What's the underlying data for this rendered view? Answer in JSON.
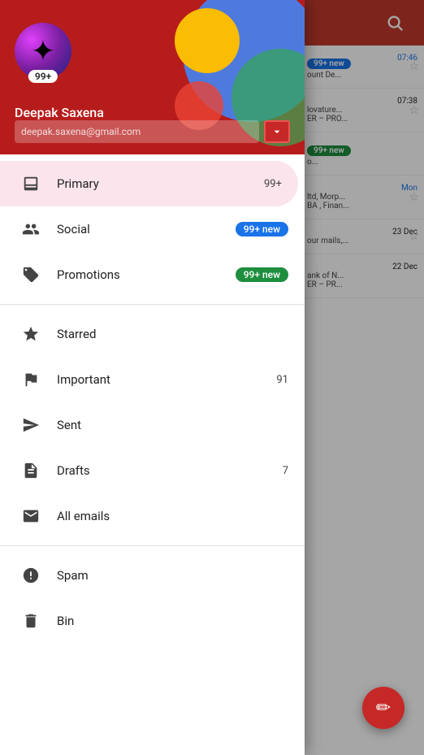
{
  "header": {
    "search_label": "Search"
  },
  "drawer": {
    "user_name": "Deepak Saxena",
    "user_email": "deepak.saxena@gmail.com",
    "unread_count": "99+",
    "nav_items": [
      {
        "id": "primary",
        "label": "Primary",
        "count": "99+",
        "badge": null,
        "active": true,
        "icon": "inbox"
      },
      {
        "id": "social",
        "label": "Social",
        "count": null,
        "badge": "99+ new",
        "badge_color": "blue",
        "active": false,
        "icon": "social"
      },
      {
        "id": "promotions",
        "label": "Promotions",
        "count": null,
        "badge": "99+ new",
        "badge_color": "green",
        "active": false,
        "icon": "promotions"
      },
      {
        "id": "starred",
        "label": "Starred",
        "count": null,
        "badge": null,
        "active": false,
        "icon": "star"
      },
      {
        "id": "important",
        "label": "Important",
        "count": "91",
        "badge": null,
        "active": false,
        "icon": "important"
      },
      {
        "id": "sent",
        "label": "Sent",
        "count": null,
        "badge": null,
        "active": false,
        "icon": "sent"
      },
      {
        "id": "drafts",
        "label": "Drafts",
        "count": "7",
        "badge": null,
        "active": false,
        "icon": "drafts"
      },
      {
        "id": "all",
        "label": "All emails",
        "count": null,
        "badge": null,
        "active": false,
        "icon": "all"
      },
      {
        "id": "spam",
        "label": "Spam",
        "count": null,
        "badge": null,
        "active": false,
        "icon": "spam"
      },
      {
        "id": "bin",
        "label": "Bin",
        "count": null,
        "badge": null,
        "active": false,
        "icon": "bin"
      }
    ]
  },
  "email_bg": {
    "items": [
      {
        "badge": "99+ new",
        "badge_color": "blue",
        "time": "07:46",
        "snippet": "ount De...",
        "has_star": true
      },
      {
        "badge": null,
        "time": "07:38",
        "snippet": "lovature...",
        "snippet2": "ER – PRO...",
        "has_star": true
      },
      {
        "badge": "99+ new",
        "badge_color": "green",
        "time": "",
        "snippet": "o...",
        "has_star": false
      },
      {
        "badge": null,
        "time": "Mon",
        "time_color": "blue",
        "snippet": "ltd, Morp...",
        "snippet2": "BA , Finan...",
        "has_star": true
      },
      {
        "badge": null,
        "time": "23 Dec",
        "snippet": "our mails,...",
        "has_star": true
      },
      {
        "badge": null,
        "time": "22 Dec",
        "snippet": "ank of N...",
        "snippet2": "ER – PR...",
        "has_star": false
      }
    ]
  },
  "fab": {
    "icon": "✏"
  }
}
